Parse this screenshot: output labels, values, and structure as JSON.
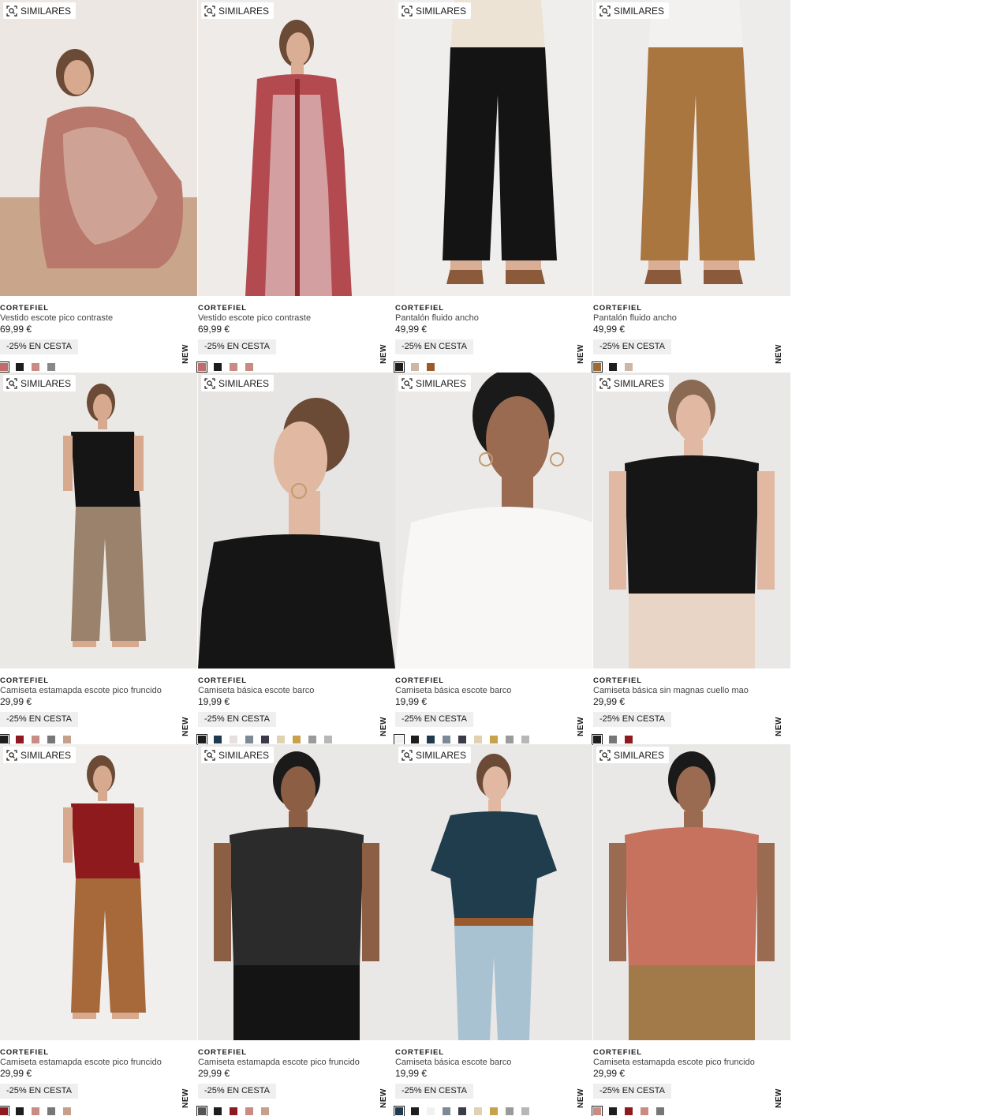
{
  "products": [
    {
      "brand": "CORTEFIEL",
      "name": "Vestido escote pico contraste",
      "price": "69,99 €",
      "promo": "-25% EN CESTA",
      "similar_label": "SIMILARES",
      "new_label": "NEW",
      "photo": {
        "bg": "#ece7e2",
        "floor": "#c9a58c",
        "garment": "#b8786c",
        "garment2": "#e8d6c8",
        "skin": "#d7aa8f",
        "hair": "#6b4a36",
        "pose": "crouch"
      },
      "swatches": [
        "#c06c6a",
        "#1d1d1d",
        "#c98c84",
        "#888888"
      ]
    },
    {
      "brand": "CORTEFIEL",
      "name": "Vestido escote pico contraste",
      "price": "69,99 €",
      "promo": "-25% EN CESTA",
      "similar_label": "SIMILARES",
      "new_label": "NEW",
      "photo": {
        "bg": "#eeebe9",
        "floor": "#eeebe9",
        "garment": "#b24a50",
        "garment2": "#f1e6e1",
        "skin": "#d9ae95",
        "hair": "#6b4a36",
        "pose": "dress"
      },
      "swatches": [
        "#c06c6a",
        "#1d1d1d",
        "#c98c84",
        "#c78c80"
      ]
    },
    {
      "brand": "CORTEFIEL",
      "name": "Pantalón fluido ancho",
      "price": "49,99 €",
      "promo": "-25% EN CESTA",
      "similar_label": "SIMILARES",
      "new_label": "NEW",
      "photo": {
        "bg": "#efeeec",
        "floor": "#efeeec",
        "garment": "#141414",
        "garment2": "#ece3d4",
        "skin": "#d9ae95",
        "hair": "#000000",
        "pose": "pants"
      },
      "swatches": [
        "#1d1d1d",
        "#cdb6a6",
        "#9b5a2a"
      ]
    },
    {
      "brand": "CORTEFIEL",
      "name": "Pantalón fluido ancho",
      "price": "49,99 €",
      "promo": "-25% EN CESTA",
      "similar_label": "SIMILARES",
      "new_label": "NEW",
      "photo": {
        "bg": "#eeeceb",
        "floor": "#eeeceb",
        "garment": "#a97640",
        "garment2": "#f3f1ef",
        "skin": "#d9ae95",
        "hair": "#000000",
        "pose": "pants"
      },
      "swatches": [
        "#9b6a36",
        "#1d1d1d",
        "#cdb6a6"
      ]
    },
    {
      "brand": "CORTEFIEL",
      "name": "Camiseta estamapda escote pico fruncido",
      "price": "29,99 €",
      "promo": "-25% EN CESTA",
      "similar_label": "SIMILARES",
      "new_label": "NEW",
      "photo": {
        "bg": "#ebe9e6",
        "floor": "#ebe9e6",
        "garment": "#151515",
        "garment2": "#9a826c",
        "skin": "#d7aa8f",
        "hair": "#6b4a36",
        "pose": "full"
      },
      "swatches": [
        "#1d1d1d",
        "#8c1a1e",
        "#c98c84",
        "#777777",
        "#c7a08c"
      ]
    },
    {
      "brand": "CORTEFIEL",
      "name": "Camiseta básica escote barco",
      "price": "19,99 €",
      "promo": "-25% EN CESTA",
      "similar_label": "SIMILARES",
      "new_label": "NEW",
      "photo": {
        "bg": "#e6e5e3",
        "floor": "#e6e5e3",
        "garment": "#151515",
        "garment2": "#151515",
        "skin": "#e1b9a2",
        "hair": "#6b4a36",
        "pose": "profile"
      },
      "swatches": [
        "#1d1d1d",
        "#1e3a4c",
        "#e8dfe0",
        "#7d8a96",
        "#3a3a48",
        "#dfd1b2",
        "#c8a24a",
        "#9a9a9a",
        "#b7b7b7"
      ]
    },
    {
      "brand": "CORTEFIEL",
      "name": "Camiseta básica escote barco",
      "price": "19,99 €",
      "promo": "-25% EN CESTA",
      "similar_label": "SIMILARES",
      "new_label": "NEW",
      "photo": {
        "bg": "#eceae8",
        "floor": "#eceae8",
        "garment": "#f8f7f5",
        "garment2": "#f8f7f5",
        "skin": "#9a6b50",
        "hair": "#1a1a1a",
        "pose": "portrait"
      },
      "swatches": [
        "#f1f1f1",
        "#1d1d1d",
        "#1e3a4c",
        "#7d8a96",
        "#3a3a48",
        "#dfd1b2",
        "#c8a24a",
        "#9a9a9a",
        "#b7b7b7"
      ]
    },
    {
      "brand": "CORTEFIEL",
      "name": "Camiseta básica sin magnas cuello mao",
      "price": "29,99 €",
      "promo": "-25% EN CESTA",
      "similar_label": "SIMILARES",
      "new_label": "NEW",
      "photo": {
        "bg": "#e9e8e6",
        "floor": "#e9e8e6",
        "garment": "#161616",
        "garment2": "#e8d5c6",
        "skin": "#e1b9a2",
        "hair": "#8a6a52",
        "pose": "torso"
      },
      "swatches": [
        "#1d1d1d",
        "#777777",
        "#8c1a1e"
      ]
    },
    {
      "brand": "CORTEFIEL",
      "name": "Camiseta estamapda escote pico fruncido",
      "price": "29,99 €",
      "promo": "-25% EN CESTA",
      "similar_label": "SIMILARES",
      "new_label": "NEW",
      "photo": {
        "bg": "#f1efed",
        "floor": "#f1efed",
        "garment": "#8e1a1e",
        "garment2": "#a7683a",
        "skin": "#d7aa8f",
        "hair": "#6b4a36",
        "pose": "full"
      },
      "swatches": [
        "#8c1a1e",
        "#1d1d1d",
        "#c98c84",
        "#777777",
        "#c7a08c"
      ]
    },
    {
      "brand": "CORTEFIEL",
      "name": "Camiseta estamapda escote pico fruncido",
      "price": "29,99 €",
      "promo": "-25% EN CESTA",
      "similar_label": "SIMILARES",
      "new_label": "NEW",
      "photo": {
        "bg": "#e9e8e6",
        "floor": "#e9e8e6",
        "garment": "#2b2b2b",
        "garment2": "#141414",
        "skin": "#8c5f44",
        "hair": "#1a1a1a",
        "pose": "torso"
      },
      "swatches": [
        "#555555",
        "#1d1d1d",
        "#8c1a1e",
        "#c98c84",
        "#c7a08c"
      ]
    },
    {
      "brand": "CORTEFIEL",
      "name": "Camiseta básica escote barco",
      "price": "19,99 €",
      "promo": "-25% EN CESTA",
      "similar_label": "SIMILARES",
      "new_label": "NEW",
      "photo": {
        "bg": "#e9e8e6",
        "floor": "#e9e8e6",
        "garment": "#1f3d4d",
        "garment2": "#a9c2d2",
        "skin": "#e1b9a2",
        "hair": "#6b4a36",
        "pose": "jeans"
      },
      "swatches": [
        "#1e3a4c",
        "#1d1d1d",
        "#f1f1f1",
        "#7d8a96",
        "#3a3a48",
        "#dfd1b2",
        "#c8a24a",
        "#9a9a9a",
        "#b7b7b7"
      ]
    },
    {
      "brand": "CORTEFIEL",
      "name": "Camiseta estamapda escote pico fruncido",
      "price": "29,99 €",
      "promo": "-25% EN CESTA",
      "similar_label": "SIMILARES",
      "new_label": "NEW",
      "photo": {
        "bg": "#e9e8e6",
        "floor": "#e9e8e6",
        "garment": "#c7725f",
        "garment2": "#a27a4a",
        "skin": "#9a6b50",
        "hair": "#1a1a1a",
        "pose": "torso"
      },
      "swatches": [
        "#c98c84",
        "#1d1d1d",
        "#8c1a1e",
        "#c98c84",
        "#777777"
      ]
    }
  ]
}
